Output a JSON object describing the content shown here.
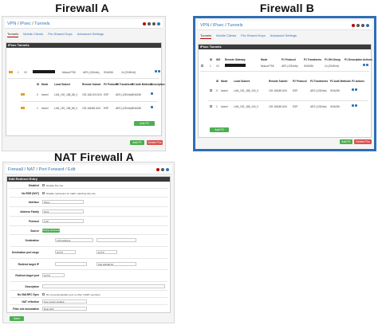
{
  "labels": {
    "fw_a": "Firewall A",
    "fw_b": "Firewall B",
    "nat_a": "NAT Firewall A"
  },
  "shotA": {
    "breadcrumb": [
      "VPN",
      "IPsec",
      "Tunnels"
    ],
    "tabs": [
      "Tunnels",
      "Mobile Clients",
      "Pre-Shared Keys",
      "Advanced Settings"
    ],
    "panel_title": "IPsec Tunnels",
    "p1_headers": [
      "ID",
      "IKE",
      "Remote Gateway",
      "Mode",
      "P1 Protocol",
      "P1 Transforms",
      "P1 DH-Group",
      "P1 Description",
      "Actions"
    ],
    "p1_row": {
      "id": "1",
      "ike": "V2",
      "mode": "Mutual PSK",
      "protocol": "AES (128 bits)",
      "transforms": "SHA256",
      "dh": "14 (2048 bit)"
    },
    "p2_headers": [
      "ID",
      "Mode",
      "Local Subnet",
      "Remote Subnet",
      "P2 Protocol",
      "P2 Transforms",
      "P2 Auth Methods",
      "P2 actions",
      "Description"
    ],
    "p2_rows": [
      {
        "id": "0",
        "mode": "tunnel",
        "local": "LAN_192_168_88_0",
        "remote": "192.168.100.0/24",
        "protocol": "ESP",
        "transforms": "AES (128 bits)",
        "auth": "SHA256"
      },
      {
        "id": "1",
        "mode": "tunnel",
        "local": "LAN_192_168_88_0",
        "remote": "192.168.88.0/24",
        "protocol": "ESP",
        "transforms": "AES (128 bits)",
        "auth": "SHA256"
      }
    ],
    "add_p2": "Add P2",
    "add_p1": "Add P1",
    "delete_p1": "Delete P1s"
  },
  "shotB": {
    "breadcrumb": [
      "VPN",
      "IPsec",
      "Tunnels"
    ],
    "tabs": [
      "Tunnels",
      "Mobile Clients",
      "Pre-Shared Keys",
      "Advanced Settings"
    ],
    "panel_title": "IPsec Tunnels",
    "p1_headers": [
      "ID",
      "IKE",
      "Remote Gateway",
      "Mode",
      "P1 Protocol",
      "P1 Transforms",
      "P1 DH-Group",
      "P1 Description",
      "Actions"
    ],
    "p1_row": {
      "id": "1",
      "ike": "V2",
      "mode": "Mutual PSK",
      "protocol": "AES (128 bits)",
      "transforms": "SHA256",
      "dh": "14 (2048 bit)"
    },
    "p2_headers": [
      "ID",
      "Mode",
      "Local Subnet",
      "Remote Subnet",
      "P2 Protocol",
      "P2 Transforms",
      "P2 Auth Methods",
      "P2 actions"
    ],
    "p2_rows": [
      {
        "id": "0",
        "mode": "tunnel",
        "local": "LAN_192_168_100_0",
        "remote": "192.168.88.0/24",
        "protocol": "ESP",
        "transforms": "AES (128 bits)",
        "auth": "SHA256"
      },
      {
        "id": "1",
        "mode": "tunnel",
        "local": "LAN_192_168_100_0",
        "remote": "192.168.88.0/24",
        "protocol": "ESP",
        "transforms": "AES (128 bits)",
        "auth": "SHA256"
      }
    ],
    "add_p2": "Add P2",
    "add_p1": "Add P1",
    "delete_p1": "Delete P1s"
  },
  "shotNat": {
    "breadcrumb": [
      "Firewall",
      "NAT",
      "Port Forward",
      "Edit"
    ],
    "panel_title": "Edit Redirect Entry",
    "fields": [
      {
        "label": "Disabled",
        "value": "Disable this rule"
      },
      {
        "label": "No RDR (NOT)",
        "value": "Disable redirection for traffic matching this rule"
      },
      {
        "label": "Interface",
        "value": "IPsec"
      },
      {
        "label": "Address Family",
        "value": "IPv4"
      },
      {
        "label": "Protocol",
        "value": "TCP"
      },
      {
        "label": "Source",
        "value": "Display Advanced"
      },
      {
        "label": "Destination",
        "value": "LAN address"
      },
      {
        "label": "Destination port range",
        "value": "HTTP"
      },
      {
        "label": "Redirect target IP",
        "value": "192.168.88.10"
      },
      {
        "label": "Redirect target port",
        "value": "HTTP"
      },
      {
        "label": "Description",
        "value": ""
      },
      {
        "label": "No XMLRPC Sync",
        "value": "Do not automatically sync to other CARP members"
      },
      {
        "label": "NAT reflection",
        "value": "Use system default"
      },
      {
        "label": "Filter rule association",
        "value": "Rule NAT"
      }
    ],
    "save": "Save"
  },
  "colors": {
    "accent": "#3273b8",
    "green": "#4caf50",
    "red": "#d9534f",
    "panel_header": "#3a3a3a",
    "highlight_border": "#2f6db5"
  }
}
